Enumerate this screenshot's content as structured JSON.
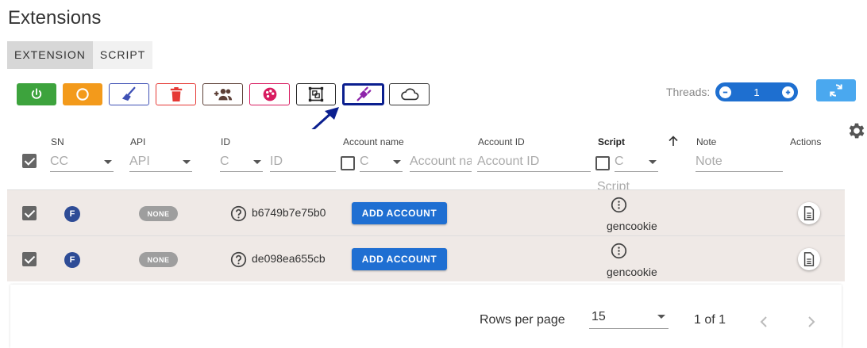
{
  "page": {
    "title": "Extensions"
  },
  "tabs": [
    {
      "label": "EXTENSION",
      "active": true
    },
    {
      "label": "SCRIPT",
      "active": false
    }
  ],
  "toolbar": {
    "buttons": [
      {
        "icon": "power-icon",
        "color": "#3da33d"
      },
      {
        "icon": "circle-icon",
        "color": "#f39a1b"
      },
      {
        "icon": "broom-icon",
        "color": "#3f51b5"
      },
      {
        "icon": "trash-icon",
        "color": "#e53935"
      },
      {
        "icon": "add-users-icon",
        "color": "#5d4037"
      },
      {
        "icon": "palette-icon",
        "color": "#d81b60"
      },
      {
        "icon": "bounding-box-icon",
        "color": "#222222"
      },
      {
        "icon": "plug-icon",
        "color": "#8e24aa"
      },
      {
        "icon": "cloud-icon",
        "color": "#333333"
      }
    ]
  },
  "threads": {
    "label": "Threads:",
    "value": "1"
  },
  "table": {
    "columns": {
      "sn": "SN",
      "api": "API",
      "id": "ID",
      "account_name": "Account name",
      "account_id": "Account ID",
      "script": "Script",
      "note": "Note",
      "actions": "Actions"
    },
    "filters": {
      "sn_select": "CC",
      "api_select": "API",
      "id_select": "C",
      "id_input": "ID",
      "account_name_select": "C",
      "account_name_input": "Account na",
      "account_id_input": "Account ID",
      "script_select": "C",
      "script_input": "Script",
      "note_input": "Note"
    },
    "rows": [
      {
        "sn_badge": "F",
        "api": "NONE",
        "id": "b6749b7e75b0",
        "action": "ADD ACCOUNT",
        "script": "gencookie"
      },
      {
        "sn_badge": "F",
        "api": "NONE",
        "id": "de098ea655cb",
        "action": "ADD ACCOUNT",
        "script": "gencookie"
      }
    ]
  },
  "pagination": {
    "rows_per_page_label": "Rows per page",
    "rows_per_page_value": "15",
    "page_info": "1 of 1"
  }
}
